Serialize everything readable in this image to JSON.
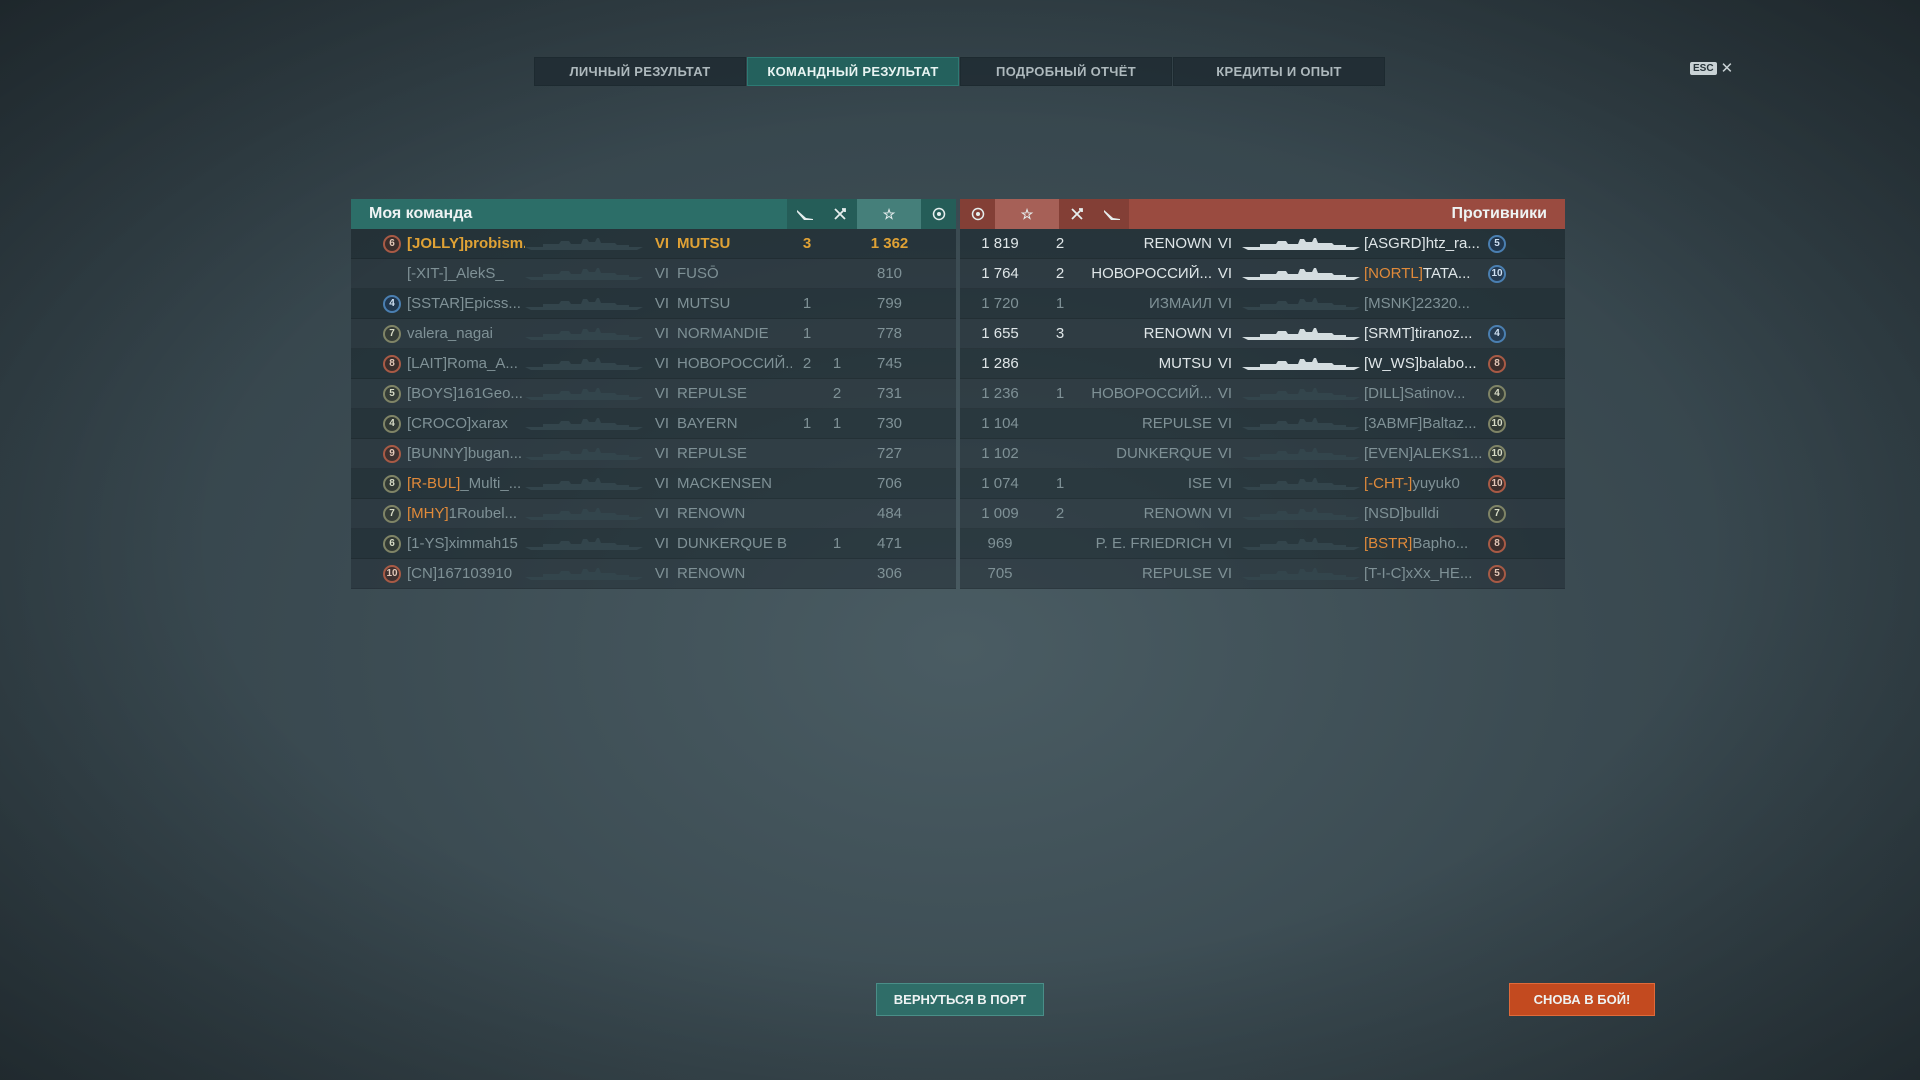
{
  "tabs": [
    {
      "label": "ЛИЧНЫЙ РЕЗУЛЬТАТ",
      "active": false
    },
    {
      "label": "КОМАНДНЫЙ РЕЗУЛЬТАТ",
      "active": true
    },
    {
      "label": "ПОДРОБНЫЙ ОТЧЁТ",
      "active": false
    },
    {
      "label": "КРЕДИТЫ И ОПЫТ",
      "active": false
    }
  ],
  "esc_label": "ESC",
  "close_glyph": "✕",
  "my_team": {
    "title": "Моя команда",
    "header_icons": [
      "planes-destroyed-icon",
      "ships-destroyed-icon",
      "star-icon",
      "base-capture-icon"
    ],
    "rows": [
      {
        "badge": "6",
        "badge_color": "red",
        "clan": "[JOLLY]",
        "name": "probism...",
        "tier": "VI",
        "ship": "MUTSU",
        "k1": "3",
        "k2": "",
        "xp": "1 362",
        "style": "me"
      },
      {
        "badge": "",
        "badge_color": "",
        "clan": "[-XIT-]",
        "name": "_AlekS_",
        "tier": "VI",
        "ship": "FUSŌ",
        "k1": "",
        "k2": "",
        "xp": "810",
        "style": "dim"
      },
      {
        "badge": "4",
        "badge_color": "blue",
        "clan": "[SSTAR]",
        "name": "Epicss...",
        "tier": "VI",
        "ship": "MUTSU",
        "k1": "1",
        "k2": "",
        "xp": "799",
        "style": "dim"
      },
      {
        "badge": "7",
        "badge_color": "olive",
        "clan": "",
        "name": "valera_nagai",
        "tier": "VI",
        "ship": "NORMANDIE",
        "k1": "1",
        "k2": "",
        "xp": "778",
        "style": "dim"
      },
      {
        "badge": "8",
        "badge_color": "red",
        "clan": "[LAIT]",
        "name": "Roma_A...",
        "tier": "VI",
        "ship": "НОВОРОССИЙ...",
        "k1": "2",
        "k2": "1",
        "xp": "745",
        "style": "dim"
      },
      {
        "badge": "5",
        "badge_color": "olive",
        "clan": "[BOYS]",
        "name": "161Geo...",
        "tier": "VI",
        "ship": "REPULSE",
        "k1": "",
        "k2": "2",
        "xp": "731",
        "style": "dim"
      },
      {
        "badge": "4",
        "badge_color": "olive",
        "clan": "[CROCO]",
        "name": "xarax",
        "tier": "VI",
        "ship": "BAYERN",
        "k1": "1",
        "k2": "1",
        "xp": "730",
        "style": "dim"
      },
      {
        "badge": "9",
        "badge_color": "red",
        "clan": "[BUNNY]",
        "name": "bugan...",
        "tier": "VI",
        "ship": "REPULSE",
        "k1": "",
        "k2": "",
        "xp": "727",
        "style": "dim"
      },
      {
        "badge": "8",
        "badge_color": "olive",
        "clan": "[R-BUL]",
        "name": "_Multi_...",
        "tier": "VI",
        "ship": "MACKENSEN",
        "k1": "",
        "k2": "",
        "xp": "706",
        "style": "dim",
        "clan_orange": true
      },
      {
        "badge": "7",
        "badge_color": "olive",
        "clan": "[MHY]",
        "name": "1Roubel...",
        "tier": "VI",
        "ship": "RENOWN",
        "k1": "",
        "k2": "",
        "xp": "484",
        "style": "dim",
        "clan_orange": true
      },
      {
        "badge": "6",
        "badge_color": "olive",
        "clan": "[1-YS]",
        "name": "ximmah15",
        "tier": "VI",
        "ship": "DUNKERQUE B",
        "k1": "",
        "k2": "1",
        "xp": "471",
        "style": "dim"
      },
      {
        "badge": "10",
        "badge_color": "red",
        "clan": "[CN]",
        "name": "167103910",
        "tier": "VI",
        "ship": "RENOWN",
        "k1": "",
        "k2": "",
        "xp": "306",
        "style": "dim"
      }
    ]
  },
  "enemy_team": {
    "title": "Противники",
    "header_icons": [
      "base-capture-icon",
      "star-icon",
      "ships-destroyed-icon",
      "planes-destroyed-icon"
    ],
    "rows": [
      {
        "xp": "1 819",
        "k1": "2",
        "ship": "RENOWN",
        "tier": "VI",
        "clan": "[ASGRD]",
        "name": "htz_ra...",
        "badge": "5",
        "badge_color": "blue",
        "style": "normal"
      },
      {
        "xp": "1 764",
        "k1": "2",
        "ship": "НОВОРОССИЙ...",
        "tier": "VI",
        "clan": "[NORTL]",
        "name": "TATA...",
        "badge": "10",
        "badge_color": "blue",
        "style": "normal",
        "clan_orange": true
      },
      {
        "xp": "1 720",
        "k1": "1",
        "ship": "ИЗМАИЛ",
        "tier": "VI",
        "clan": "[MSNK]",
        "name": "22320...",
        "badge": "",
        "badge_color": "",
        "style": "dim"
      },
      {
        "xp": "1 655",
        "k1": "3",
        "ship": "RENOWN",
        "tier": "VI",
        "clan": "[SRMT]",
        "name": "tiranoz...",
        "badge": "4",
        "badge_color": "blue",
        "style": "normal"
      },
      {
        "xp": "1 286",
        "k1": "",
        "ship": "MUTSU",
        "tier": "VI",
        "clan": "[W_WS]",
        "name": "balabo...",
        "badge": "8",
        "badge_color": "red",
        "style": "normal"
      },
      {
        "xp": "1 236",
        "k1": "1",
        "ship": "НОВОРОССИЙ...",
        "tier": "VI",
        "clan": "[DILL]",
        "name": "Satinov...",
        "badge": "4",
        "badge_color": "olive",
        "style": "dim"
      },
      {
        "xp": "1 104",
        "k1": "",
        "ship": "REPULSE",
        "tier": "VI",
        "clan": "[3ABMF]",
        "name": "Baltaz...",
        "badge": "10",
        "badge_color": "olive",
        "style": "dim"
      },
      {
        "xp": "1 102",
        "k1": "",
        "ship": "DUNKERQUE",
        "tier": "VI",
        "clan": "[EVEN]",
        "name": "ALEKS1...",
        "badge": "10",
        "badge_color": "olive",
        "style": "dim"
      },
      {
        "xp": "1 074",
        "k1": "1",
        "ship": "ISE",
        "tier": "VI",
        "clan": "[-CHT-]",
        "name": "yuyuk0",
        "badge": "10",
        "badge_color": "red",
        "style": "dim",
        "clan_orange": true
      },
      {
        "xp": "1 009",
        "k1": "2",
        "ship": "RENOWN",
        "tier": "VI",
        "clan": "[NSD]",
        "name": "bulldi",
        "badge": "7",
        "badge_color": "olive",
        "style": "dim"
      },
      {
        "xp": "969",
        "k1": "",
        "ship": "P. E. FRIEDRICH",
        "tier": "VI",
        "clan": "[BSTR]",
        "name": "Bapho...",
        "badge": "8",
        "badge_color": "red",
        "style": "dim",
        "clan_orange": true
      },
      {
        "xp": "705",
        "k1": "",
        "ship": "REPULSE",
        "tier": "VI",
        "clan": "[T-I-C]",
        "name": "xXx_HE...",
        "badge": "5",
        "badge_color": "red",
        "style": "dim"
      }
    ]
  },
  "buttons": {
    "return_to_port": "ВЕРНУТЬСЯ В ПОРТ",
    "battle_again": "СНОВА В БОЙ!"
  }
}
